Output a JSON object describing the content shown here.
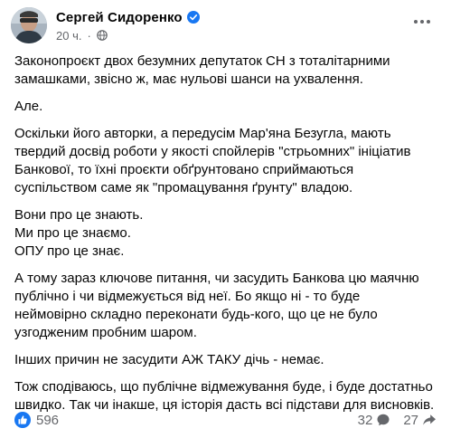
{
  "post": {
    "author": "Сергей Сидоренко",
    "time": "20 ч.",
    "paragraphs": [
      "Законопроєкт двох безумних депутаток СН з тоталітарними\nзамашками, звісно ж, має нульові шанси на ухвалення.",
      "Але.",
      "Оскільки його авторки, а передусім Мар'яна Безугла, мають\nтвердий досвід роботи у якості спойлерів \"стрьомних\" ініціатив\nБанкової, то їхні проєкти обґрунтовано сприймаються\nсуспільством саме як \"промацування ґрунту\" владою.",
      "Вони про це знають.\nМи про це знаємо.\nОПУ про це знає.",
      "А тому зараз ключове питання, чи засудить Банкова цю маячню\nпублічно і чи відмежується від неї. Бо якщо ні - то буде\nнеймовірно складно переконати будь-кого, що це не було\nузгодженим пробним шаром.",
      "Інших причин не засудити АЖ ТАКУ дічь - немає.",
      "Тож сподіваюсь, що публічне відмежування буде, і буде достатньо\nшвидко. Так чи інакше, ця історія дасть всі підстави для висновків."
    ]
  },
  "reactions": {
    "likes": "596",
    "comments": "32",
    "shares": "27"
  },
  "icons": {
    "verified": "verified-badge-icon",
    "globe": "globe-icon",
    "like": "like-icon",
    "comment": "comment-icon",
    "share": "share-icon",
    "more": "more-options-icon"
  },
  "colors": {
    "accent": "#1877f2",
    "secondary_text": "#65676b",
    "primary_text": "#050505"
  }
}
